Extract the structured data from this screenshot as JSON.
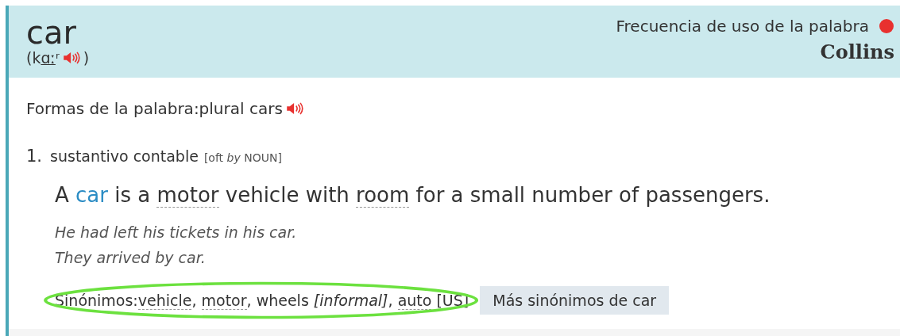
{
  "header": {
    "headword": "car",
    "pronunciation": {
      "before": "(k",
      "underlined": "ɑː",
      "after": "ʳ",
      "close": ")"
    },
    "frequency_label": "Frecuencia de uso de la palabra",
    "source": "Collins"
  },
  "word_forms": {
    "label": "Formas de la palabra:",
    "value": "plural cars"
  },
  "senses": [
    {
      "number": "1.",
      "grammar": "sustantivo contable",
      "note": "[oft *by* NOUN]",
      "definition": [
        {
          "kind": "plain",
          "text": "A "
        },
        {
          "kind": "headword",
          "text": "car"
        },
        {
          "kind": "plain",
          "text": " is a "
        },
        {
          "kind": "link",
          "text": "motor"
        },
        {
          "kind": "plain",
          "text": " vehicle with "
        },
        {
          "kind": "link",
          "text": "room"
        },
        {
          "kind": "plain",
          "text": " for a small number of passengers."
        }
      ],
      "examples": [
        "He had left his tickets in his car.",
        "They arrived by car."
      ],
      "synonyms_label": "Sinónimos:",
      "synonyms": [
        {
          "kind": "link",
          "text": "vehicle"
        },
        {
          "kind": "plain",
          "text": ", "
        },
        {
          "kind": "link",
          "text": "motor"
        },
        {
          "kind": "plain",
          "text": ", wheels "
        },
        {
          "kind": "italic",
          "text": "[informal]"
        },
        {
          "kind": "plain",
          "text": ", "
        },
        {
          "kind": "link",
          "text": "auto"
        },
        {
          "kind": "plain",
          "text": " [US]"
        }
      ],
      "more_button": "Más sinónimos de car"
    }
  ]
}
